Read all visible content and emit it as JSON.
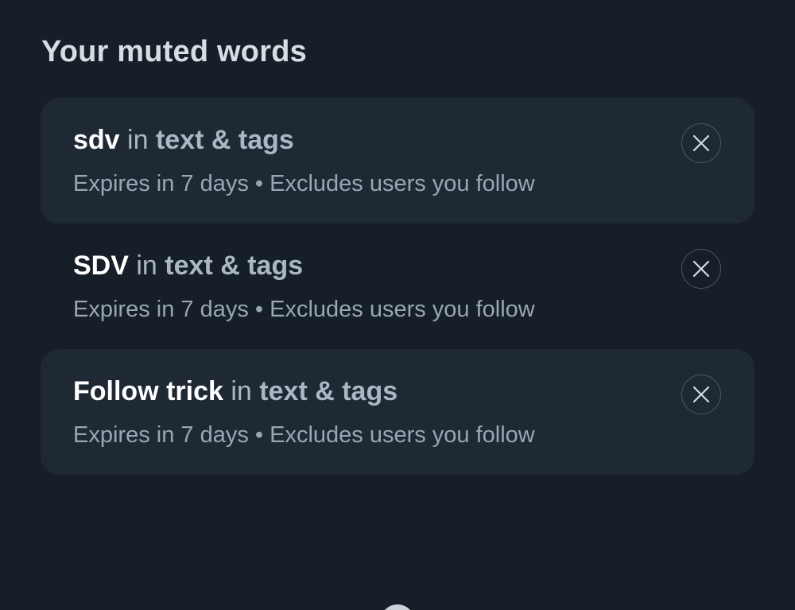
{
  "header": {
    "title": "Your muted words"
  },
  "muted_words": [
    {
      "word": "sdv",
      "connector": "in",
      "target": "text & tags",
      "meta": "Expires in 7 days • Excludes users you follow",
      "remove_icon": "close-icon"
    },
    {
      "word": "SDV",
      "connector": "in",
      "target": "text & tags",
      "meta": "Expires in 7 days • Excludes users you follow",
      "remove_icon": "close-icon"
    },
    {
      "word": "Follow trick",
      "connector": "in",
      "target": "text & tags",
      "meta": "Expires in 7 days • Excludes users you follow",
      "remove_icon": "close-icon"
    }
  ],
  "colors": {
    "background": "#161e27",
    "row_shaded": "#1f2934",
    "word": "#ffffff",
    "secondary": "#aab7c5"
  }
}
